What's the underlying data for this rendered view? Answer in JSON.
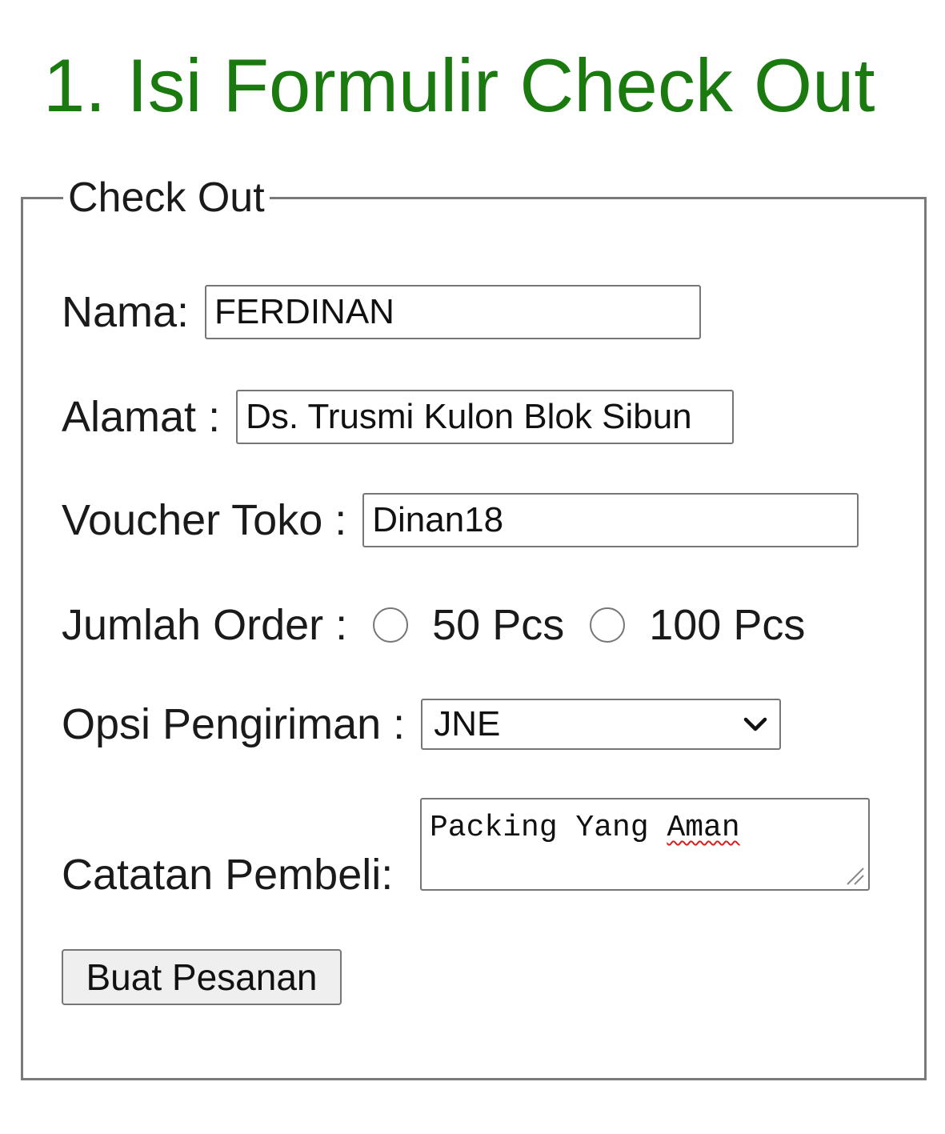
{
  "page": {
    "title": "1. Isi Formulir Check Out"
  },
  "form": {
    "legend": "Check Out",
    "nama": {
      "label": "Nama:",
      "value": "FERDINAN"
    },
    "alamat": {
      "label": "Alamat :",
      "value": "Ds. Trusmi Kulon Blok Sibun"
    },
    "voucher": {
      "label": "Voucher Toko :",
      "value": "Dinan18"
    },
    "jumlah_order": {
      "label": "Jumlah Order :",
      "options": [
        {
          "label": "50 Pcs",
          "checked": false
        },
        {
          "label": "100 Pcs",
          "checked": false
        }
      ]
    },
    "opsi_pengiriman": {
      "label": "Opsi Pengiriman :",
      "selected": "JNE"
    },
    "catatan": {
      "label": "Catatan Pembeli:",
      "value_start": "Packing Yang ",
      "value_misspelled": "Aman"
    },
    "submit_label": "Buat Pesanan"
  },
  "colors": {
    "title": "#1a7a10",
    "border": "#7a7a7a",
    "button_bg": "#efefef",
    "spellcheck": "#d42020"
  }
}
